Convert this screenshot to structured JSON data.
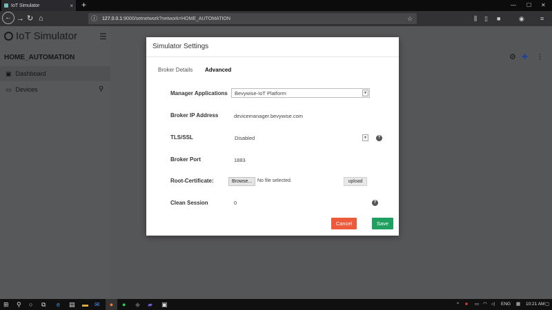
{
  "browser": {
    "tab_title": "IoT Simulator",
    "tab_close": "×",
    "new_tab": "+",
    "url_host": "127.0.0.1",
    "url_rest": ":9000/setnetwork?network=HOME_AUTOMATION",
    "win_min": "—",
    "win_max": "☐",
    "win_close": "✕"
  },
  "app": {
    "brand": "IoT Simulator",
    "project": "HOME_AUTOMATION",
    "sidebar": [
      {
        "label": "Dashboard"
      },
      {
        "label": "Devices"
      }
    ]
  },
  "modal": {
    "title": "Simulator Settings",
    "tabs": [
      "Broker Details",
      "Advanced"
    ],
    "fields": {
      "manager_label": "Manager Applications",
      "manager_value": "Bevywise-IoT Platform",
      "broker_ip_label": "Broker IP Address",
      "broker_ip_value": "devicemanager.bevywise.com",
      "tls_label": "TLS/SSL",
      "tls_value": "Disabled",
      "port_label": "Broker Port",
      "port_value": "1883",
      "cert_label": "Root-Certificate:",
      "browse": "Browse...",
      "no_file": "No file selected.",
      "upload": "upload",
      "clean_label": "Clean Session",
      "clean_value": "0"
    },
    "help": "?",
    "cancel": "Cancel",
    "save": "Save"
  },
  "taskbar": {
    "lang": "ENG",
    "time": "10:21 AM"
  },
  "colors": {
    "cancel": "#ee5a3c",
    "save": "#20a060",
    "page_bg": "#555657"
  }
}
